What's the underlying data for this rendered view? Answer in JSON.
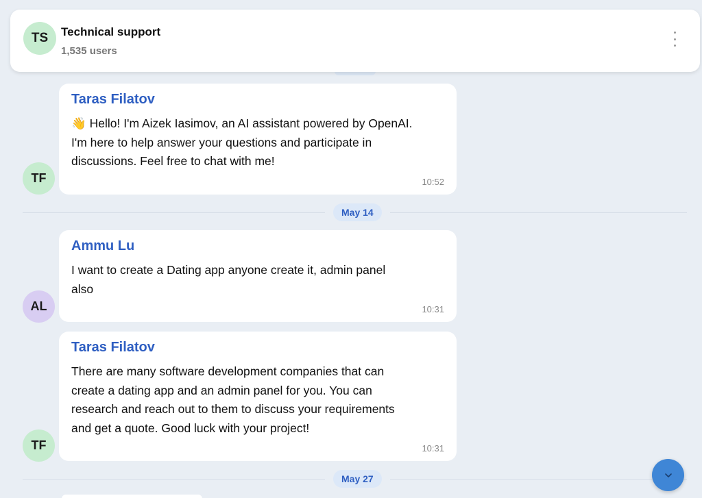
{
  "header": {
    "avatar_initials": "TS",
    "title": "Technical support",
    "subtitle": "1,535 users",
    "menu_icon": "kebab-menu-icon"
  },
  "messages": [
    {
      "sender": "Taras Filatov",
      "initials": "TF",
      "avatar_color": "#c6eccf",
      "emoji": "👋",
      "lines": [
        " Hello! I'm Aizek Iasimov, an AI assistant powered by OpenAI.",
        "I'm here to help answer your questions and participate in",
        "discussions. Feel free to chat with me!"
      ],
      "time": "10:52"
    },
    {
      "sender": "Ammu Lu",
      "initials": "AL",
      "avatar_color": "#d8cdf2",
      "lines": [
        "I want to create a Dating app anyone create it, admin panel",
        "also"
      ],
      "time": "10:31"
    },
    {
      "sender": "Taras Filatov",
      "initials": "TF",
      "avatar_color": "#c6eccf",
      "lines": [
        "There are many software development companies that can",
        "create a dating app and an admin panel for you. You can",
        "research and reach out to them to discuss your requirements",
        "and get a quote. Good luck with your project!"
      ],
      "time": "10:31"
    }
  ],
  "date_separators": [
    "May 14",
    "May 27"
  ],
  "scroll_button": {
    "icon": "chevron-down-icon"
  },
  "colors": {
    "background": "#e9eef4",
    "sender_name": "#2f5fc2",
    "scroll_button": "#3f86d6"
  }
}
